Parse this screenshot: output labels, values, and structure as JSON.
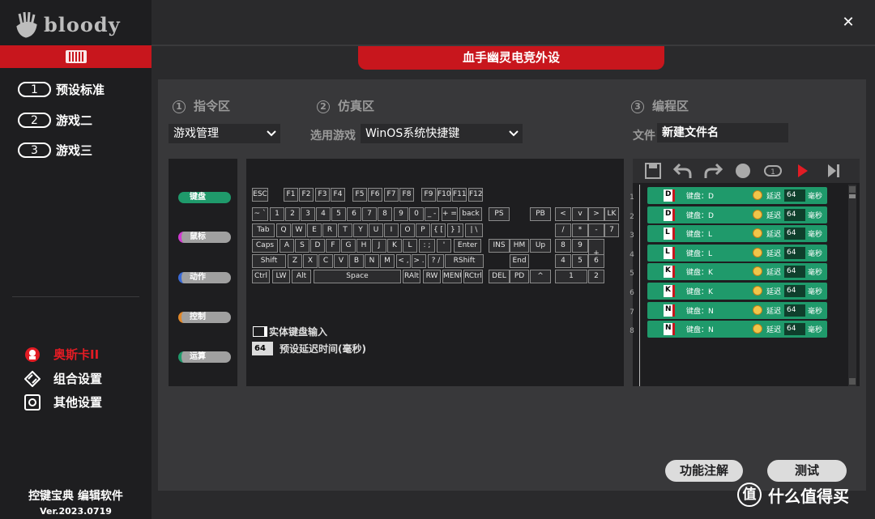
{
  "app": {
    "logo_text": "bloody"
  },
  "sidebar": {
    "profiles": [
      {
        "num": "1",
        "label": "预设标准"
      },
      {
        "num": "2",
        "label": "游戏二"
      },
      {
        "num": "3",
        "label": "游戏三"
      }
    ],
    "links": [
      {
        "label": "奥斯卡II",
        "icon": "oscar-icon",
        "color": "#e21c24"
      },
      {
        "label": "组合设置",
        "icon": "layers-icon",
        "color": "#ffffff"
      },
      {
        "label": "其他设置",
        "icon": "gear-icon",
        "color": "#ffffff"
      }
    ],
    "footer_title": "控键宝典 编辑软件",
    "footer_version": "Ver.2023.0719"
  },
  "header": {
    "device_title": "血手幽灵电竞外设"
  },
  "sections": {
    "command": {
      "num": "1",
      "title": "指令区",
      "select_value": "游戏管理"
    },
    "simulate": {
      "num": "2",
      "title": "仿真区",
      "select_label": "选用游戏",
      "select_value": "WinOS系统快捷键"
    },
    "program": {
      "num": "3",
      "title": "编程区",
      "file_label": "文件",
      "file_value": "新建文件名"
    }
  },
  "categories": [
    {
      "label": "键盘",
      "color": "#1f9a6b"
    },
    {
      "label": "鼠标",
      "color": "#d03ad0"
    },
    {
      "label": "动作",
      "color": "#3a6ad6"
    },
    {
      "label": "控制",
      "color": "#e0882a"
    },
    {
      "label": "运算",
      "color": "#1f9a6b"
    }
  ],
  "keyboard": {
    "physical_input_label": "实体键盘输入",
    "default_delay": "64",
    "default_delay_label": "预设延迟时间(毫秒)",
    "keys": [
      "ESC",
      "F1",
      "F2",
      "F3",
      "F4",
      "F5",
      "F6",
      "F7",
      "F8",
      "F9",
      "F10",
      "F11",
      "F12",
      "~ `",
      "1",
      "2",
      "3",
      "4",
      "5",
      "6",
      "7",
      "8",
      "9",
      "0",
      "_ -",
      "+ =",
      "back",
      "Tab",
      "Q",
      "W",
      "E",
      "R",
      "T",
      "Y",
      "U",
      "I",
      "O",
      "P",
      "{ [",
      "} ]",
      "| \\",
      "Caps",
      "A",
      "S",
      "D",
      "F",
      "G",
      "H",
      "J",
      "K",
      "L",
      ": ;",
      "'",
      "Enter",
      "Shift",
      "Z",
      "X",
      "C",
      "V",
      "B",
      "N",
      "M",
      "< ,",
      "> .",
      "? /",
      "RShift",
      "Ctrl",
      "LW",
      "Alt",
      "Space",
      "RAlt",
      "RW",
      "MENU",
      "RCtrl",
      "PS",
      "PB",
      "INS",
      "HM",
      "Up",
      "DEL",
      "End",
      "PD",
      "^",
      "<",
      "v",
      ">",
      "LK",
      "/",
      "*",
      "-",
      "7",
      "8",
      "9",
      "+",
      "4",
      "5",
      "6",
      "1",
      "2",
      "3",
      "0",
      "Del"
    ]
  },
  "program": {
    "toolbar": [
      "save-icon",
      "undo-icon",
      "redo-icon",
      "record-icon",
      "loop-icon",
      "run-icon",
      "step-icon"
    ],
    "delay_label": "延迟",
    "unit_label": "毫秒",
    "rows": [
      {
        "num": "1",
        "key": "D",
        "action": "键盘：D",
        "delay": "64"
      },
      {
        "num": "2",
        "key": "D",
        "action": "键盘：D",
        "delay": "64"
      },
      {
        "num": "3",
        "key": "L",
        "action": "键盘：L",
        "delay": "64"
      },
      {
        "num": "4",
        "key": "L",
        "action": "键盘：L",
        "delay": "64"
      },
      {
        "num": "5",
        "key": "K",
        "action": "键盘：K",
        "delay": "64"
      },
      {
        "num": "6",
        "key": "K",
        "action": "键盘：K",
        "delay": "64"
      },
      {
        "num": "7",
        "key": "N",
        "action": "键盘：N",
        "delay": "64"
      },
      {
        "num": "8",
        "key": "N",
        "action": "键盘：N",
        "delay": "64"
      }
    ]
  },
  "buttons": {
    "help": "功能注解",
    "test": "测试"
  },
  "watermark": {
    "logo": "值",
    "text": "什么值得买"
  }
}
